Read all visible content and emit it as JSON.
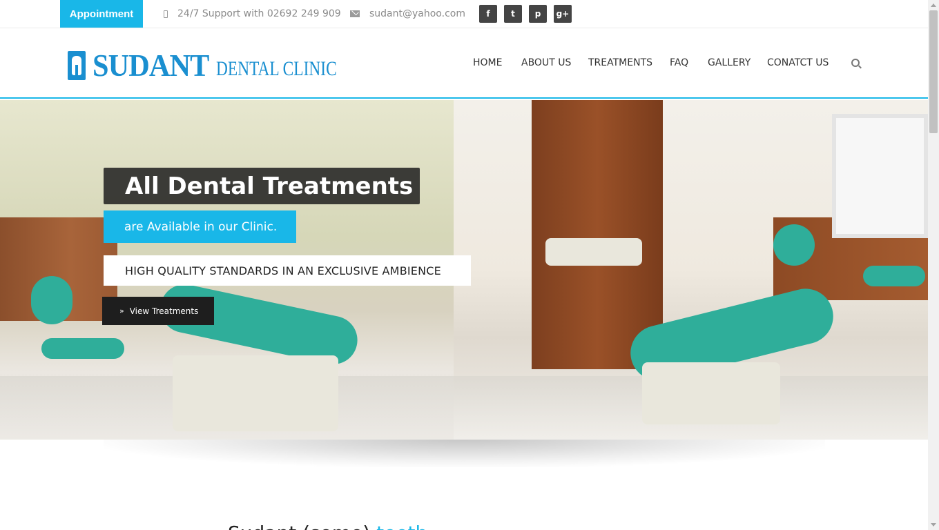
{
  "topbar": {
    "appointment_label": "Appointment",
    "support_text": "24/7 Support with 02692 249 909",
    "email_text": "sudant@yahoo.com",
    "social": [
      {
        "icon": "facebook-icon",
        "glyph": "f"
      },
      {
        "icon": "twitter-icon",
        "glyph": "t"
      },
      {
        "icon": "pinterest-icon",
        "glyph": "p"
      },
      {
        "icon": "google-plus-icon",
        "glyph": "g+"
      }
    ]
  },
  "header": {
    "logo_name": "SUDANT",
    "logo_sub": "DENTAL CLINIC",
    "nav": [
      "HOME",
      "ABOUT US",
      "TREATMENTS",
      "FAQ",
      "GALLERY",
      "CONATCT US"
    ]
  },
  "hero": {
    "title": "All Dental Treatments",
    "subtitle": "are Available in our Clinic.",
    "tagline": "HIGH QUALITY STANDARDS IN AN EXCLUSIVE AMBIENCE",
    "button_glyph": "»",
    "button_label": "View Treatments"
  },
  "intro": {
    "lead": "Sudant (some)",
    "highlight": "teeth"
  },
  "colors": {
    "accent": "#19b7e8",
    "dark": "#1e1e1e",
    "brand": "#1a8fd0"
  }
}
